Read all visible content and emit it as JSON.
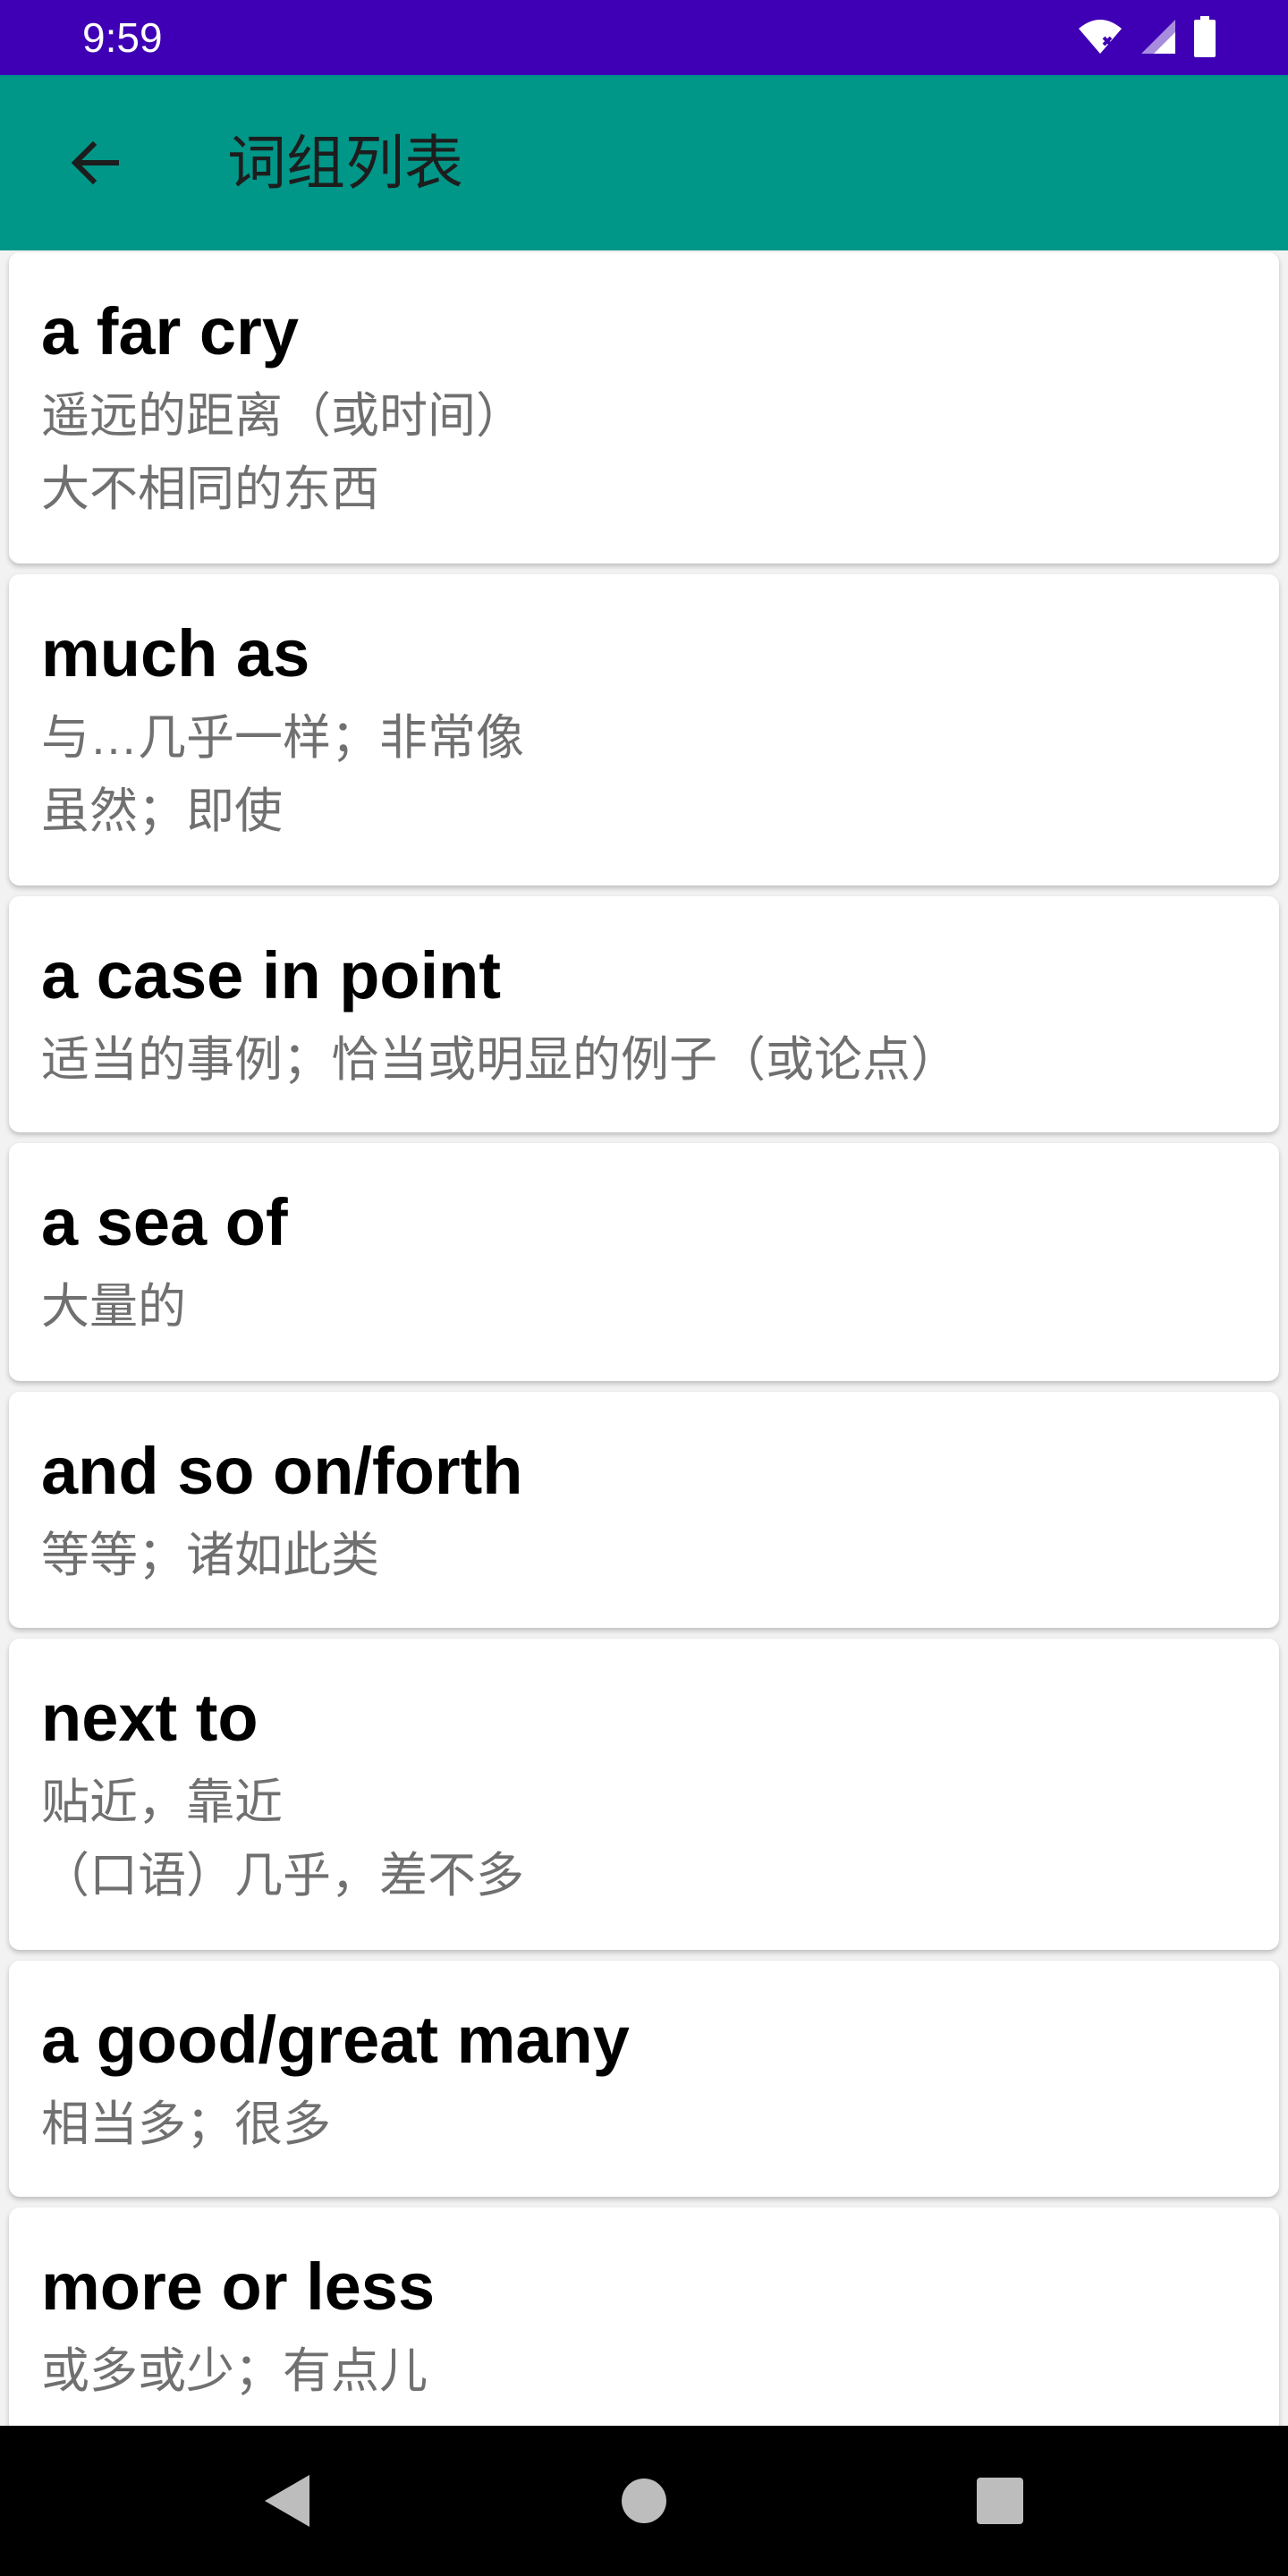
{
  "status_bar": {
    "time": "9:59",
    "icons": [
      "wifi-icon",
      "signal-icon",
      "battery-icon"
    ]
  },
  "app_bar": {
    "title": "词组列表",
    "back_icon": "arrow-left-icon"
  },
  "phrases": [
    {
      "phrase": "a far cry",
      "meanings": [
        "遥远的距离（或时间）",
        "大不相同的东西"
      ]
    },
    {
      "phrase": "much as",
      "meanings": [
        "与…几乎一样；非常像",
        "虽然；即使"
      ]
    },
    {
      "phrase": "a case in point",
      "meanings": [
        "适当的事例；恰当或明显的例子（或论点）"
      ]
    },
    {
      "phrase": "a sea of",
      "meanings": [
        "大量的"
      ]
    },
    {
      "phrase": "and so on/forth",
      "meanings": [
        "等等；诸如此类"
      ]
    },
    {
      "phrase": "next to",
      "meanings": [
        "贴近，靠近",
        "（口语）几乎，差不多"
      ]
    },
    {
      "phrase": "a good/great many",
      "meanings": [
        "相当多；很多"
      ]
    },
    {
      "phrase": "more or less",
      "meanings": [
        "或多或少；有点儿"
      ]
    }
  ],
  "nav_bar": {
    "icons": [
      "back-triangle-icon",
      "home-circle-icon",
      "recents-square-icon"
    ]
  },
  "colors": {
    "status_bar": "#3f00b5",
    "app_bar": "#009688",
    "nav_bar": "#000000"
  }
}
